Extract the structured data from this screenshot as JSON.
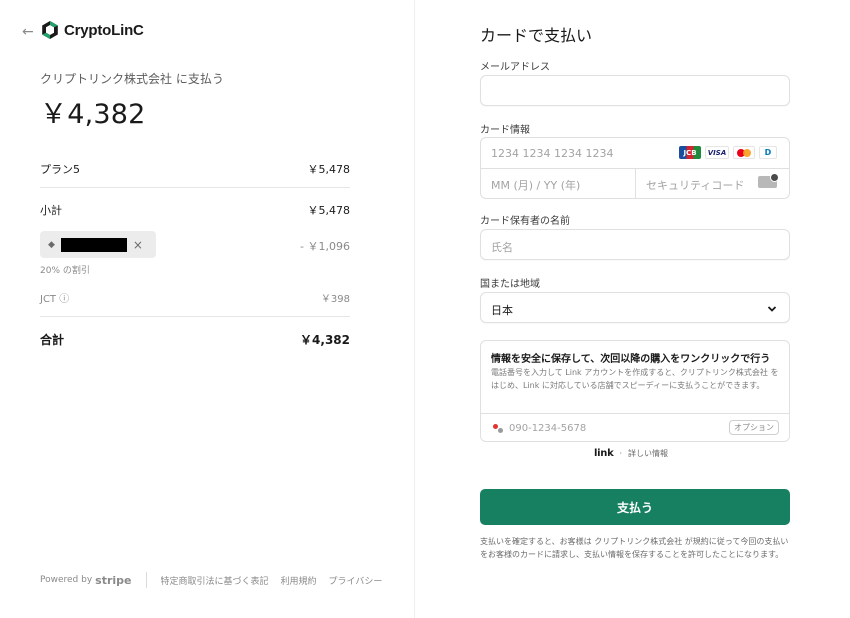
{
  "merchant": {
    "back_arrow": "←",
    "logo_text": "CryptoLinC",
    "pay_to": "クリプトリンク株式会社 に支払う",
    "total_big": "￥4,382"
  },
  "summary": {
    "plan_label": "プラン5",
    "plan_amount": "￥5,478",
    "subtotal_label": "小計",
    "subtotal_amount": "￥5,478",
    "coupon_close": "×",
    "discount_amount": "- ￥1,096",
    "discount_note": "20% の割引",
    "tax_label": "JCT ⓘ",
    "tax_amount": "￥398",
    "total_label": "合計",
    "total_amount": "￥4,382"
  },
  "footer": {
    "powered_by": "Powered by",
    "stripe": "stripe",
    "links": [
      "特定商取引法に基づく表記",
      "利用規約",
      "プライバシー"
    ]
  },
  "form": {
    "heading": "カードで支払い",
    "email_label": "メールアドレス",
    "email_value": "",
    "card_label": "カード情報",
    "card_number_placeholder": "1234 1234 1234 1234",
    "expiry_placeholder": "MM (月) / YY (年)",
    "cvc_placeholder": "セキュリティコード",
    "brands": [
      "JCB",
      "VISA",
      "MC",
      "D"
    ],
    "holder_label": "カード保有者の名前",
    "holder_placeholder": "氏名",
    "country_label": "国または地域",
    "country_value": "日本",
    "chevron": "⌄"
  },
  "link": {
    "title": "情報を安全に保存して、次回以降の購入をワンクリックで行う",
    "description": "電話番号を入力して Link アカウントを作成すると、クリプトリンク株式会社 をはじめ、Link に対応している店舗でスピーディーに支払うことができます。",
    "phone_placeholder": "090-1234-5678",
    "optional": "オプション",
    "brand": "link",
    "dot": "·",
    "more_info": "詳しい情報"
  },
  "pay_button": "支払う",
  "terms": "支払いを確定すると、お客様は クリプトリンク株式会社 が規約に従って今回の支払いをお客様のカードに請求し、支払い情報を保存することを許可したことになります。",
  "colors": {
    "accent": "#178061"
  }
}
